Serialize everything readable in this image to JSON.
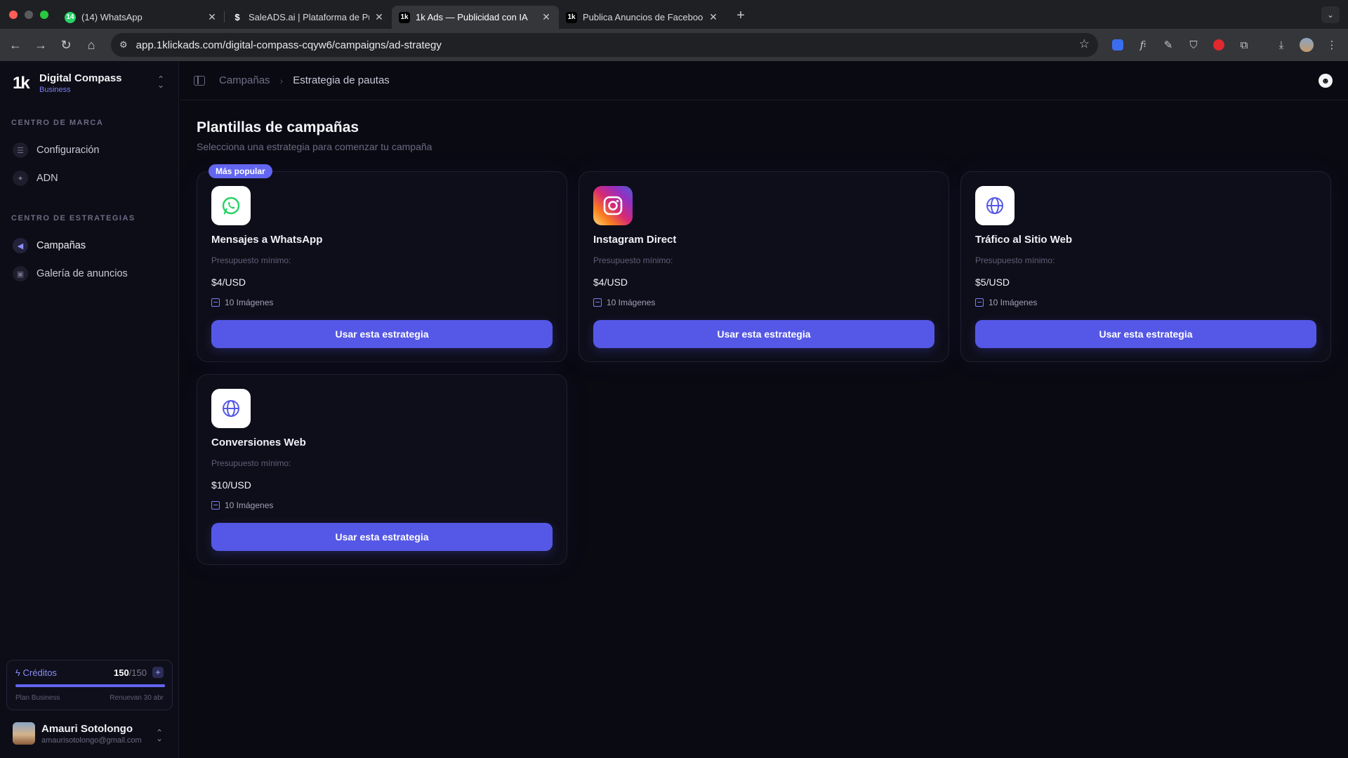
{
  "browser": {
    "tabs": [
      {
        "title": "(14) WhatsApp",
        "badge": "14"
      },
      {
        "title": "SaleADS.ai | Plataforma de Publicidad"
      },
      {
        "title": "1k Ads — Publicidad con IA"
      },
      {
        "title": "Publica Anuncios de Facebook"
      }
    ],
    "url": "app.1klickads.com/digital-compass-cqyw6/campaigns/ad-strategy"
  },
  "brand": {
    "logo": "1k",
    "name": "Digital Compass",
    "plan": "Business"
  },
  "sidebar": {
    "section1": "CENTRO DE MARCA",
    "section1_items": [
      {
        "label": "Configuración",
        "icon": "sliders-icon"
      },
      {
        "label": "ADN",
        "icon": "sparkle-icon"
      }
    ],
    "section2": "CENTRO DE ESTRATEGIAS",
    "section2_items": [
      {
        "label": "Campañas",
        "icon": "megaphone-icon"
      },
      {
        "label": "Galería de anuncios",
        "icon": "gallery-icon"
      }
    ]
  },
  "credits": {
    "label": "Créditos",
    "used": "150",
    "total": "/150",
    "fraction": 1.0,
    "plan": "Plan Business",
    "renew": "Renuevan 30 abr"
  },
  "user": {
    "name": "Amauri Sotolongo",
    "email": "amaurisotolongo@gmail.com"
  },
  "breadcrumb": {
    "parent": "Campañas",
    "current": "Estrategia de pautas"
  },
  "page": {
    "title": "Plantillas de campañas",
    "subtitle": "Selecciona una estrategia para comenzar tu campaña"
  },
  "cards": [
    {
      "badge": "Más popular",
      "name": "Mensajes a WhatsApp",
      "budget_label": "Presupuesto mínimo:",
      "price": "$4/USD",
      "images": "10 Imágenes",
      "cta": "Usar esta estrategia",
      "icon": "whatsapp-icon"
    },
    {
      "name": "Instagram Direct",
      "budget_label": "Presupuesto mínimo:",
      "price": "$4/USD",
      "images": "10 Imágenes",
      "cta": "Usar esta estrategia",
      "icon": "instagram-icon"
    },
    {
      "name": "Tráfico al Sitio Web",
      "budget_label": "Presupuesto mínimo:",
      "price": "$5/USD",
      "images": "10 Imágenes",
      "cta": "Usar esta estrategia",
      "icon": "globe-icon"
    },
    {
      "name": "Conversiones Web",
      "budget_label": "Presupuesto mínimo:",
      "price": "$10/USD",
      "images": "10 Imágenes",
      "cta": "Usar esta estrategia",
      "icon": "globe-icon"
    }
  ],
  "colors": {
    "accent": "#5558e6",
    "badge": "#6366f1",
    "background": "#0a0a13"
  }
}
